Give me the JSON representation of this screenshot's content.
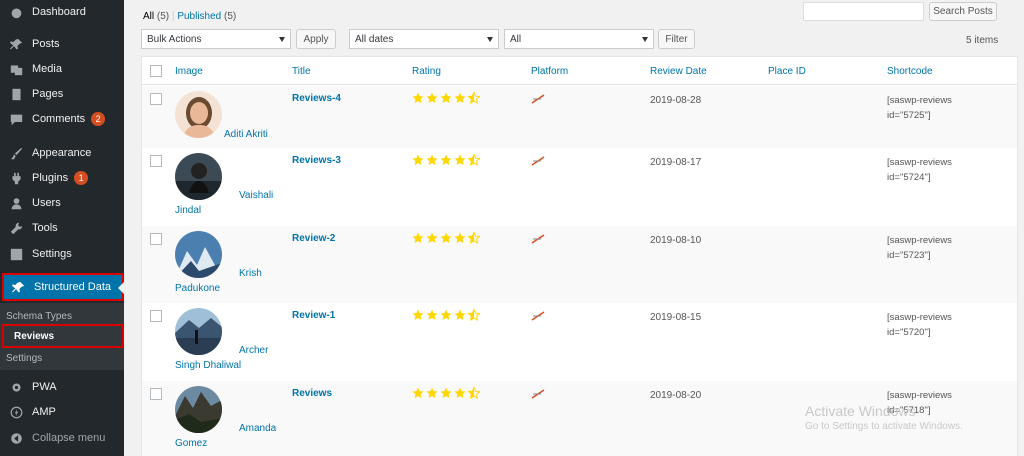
{
  "sidebar": {
    "items": [
      {
        "label": "Dashboard",
        "icon": "dashboard-icon"
      },
      {
        "label": "Posts",
        "icon": "pin-icon"
      },
      {
        "label": "Media",
        "icon": "media-icon"
      },
      {
        "label": "Pages",
        "icon": "pages-icon"
      },
      {
        "label": "Comments",
        "icon": "comment-icon",
        "badge": "2"
      },
      {
        "label": "Appearance",
        "icon": "brush-icon"
      },
      {
        "label": "Plugins",
        "icon": "plugin-icon",
        "badge": "1"
      },
      {
        "label": "Users",
        "icon": "user-icon"
      },
      {
        "label": "Tools",
        "icon": "wrench-icon"
      },
      {
        "label": "Settings",
        "icon": "settings-icon"
      }
    ],
    "active": {
      "label": "Structured Data",
      "icon": "pin-icon"
    },
    "submenu": [
      {
        "label": "Schema Types"
      },
      {
        "label": "Reviews"
      },
      {
        "label": "Settings"
      }
    ],
    "bottom": [
      {
        "label": "PWA",
        "icon": "gear-icon"
      },
      {
        "label": "AMP",
        "icon": "amp-icon"
      },
      {
        "label": "Collapse menu",
        "icon": "collapse-icon"
      }
    ]
  },
  "filters": {
    "all_label": "All",
    "all_count": "(5)",
    "separator": "|",
    "published_label": "Published",
    "published_count": "(5)",
    "search_button": "Search Posts",
    "bulk_actions": "Bulk Actions",
    "apply_button": "Apply",
    "dates": "All dates",
    "platform_filter": "All",
    "filter_button": "Filter",
    "items_count": "5 items"
  },
  "table": {
    "columns": [
      "Image",
      "Title",
      "Rating",
      "Platform",
      "Review Date",
      "Place ID",
      "Shortcode"
    ],
    "rows": [
      {
        "name_line1": "Aditi Akriti",
        "name_line2": "",
        "title": "Reviews-4",
        "rating": 4.5,
        "date": "2019-08-28",
        "shortcode_line1": "[saswp-reviews",
        "shortcode_line2": "id=\"5725\"]"
      },
      {
        "name_line1": "Vaishali",
        "name_line2": "Jindal",
        "title": "Reviews-3",
        "rating": 4.5,
        "date": "2019-08-17",
        "shortcode_line1": "[saswp-reviews",
        "shortcode_line2": "id=\"5724\"]"
      },
      {
        "name_line1": "Krish",
        "name_line2": "Padukone",
        "title": "Review-2",
        "rating": 4.5,
        "date": "2019-08-10",
        "shortcode_line1": "[saswp-reviews",
        "shortcode_line2": "id=\"5723\"]"
      },
      {
        "name_line1": "Archer",
        "name_line2": "Singh Dhaliwal",
        "title": "Review-1",
        "rating": 4.5,
        "date": "2019-08-15",
        "shortcode_line1": "[saswp-reviews",
        "shortcode_line2": "id=\"5720\"]"
      },
      {
        "name_line1": "Amanda",
        "name_line2": "Gomez",
        "title": "Reviews",
        "rating": 4.5,
        "date": "2019-08-20",
        "shortcode_line1": "[saswp-reviews",
        "shortcode_line2": "id=\"5718\"]"
      }
    ]
  },
  "watermark": {
    "line1": "Activate Windows",
    "line2": "Go to Settings to activate Windows."
  },
  "colors": {
    "sidebar_bg": "#23282d",
    "accent": "#0073aa",
    "star": "#ffd700",
    "highlight_border": "#dd0000"
  }
}
